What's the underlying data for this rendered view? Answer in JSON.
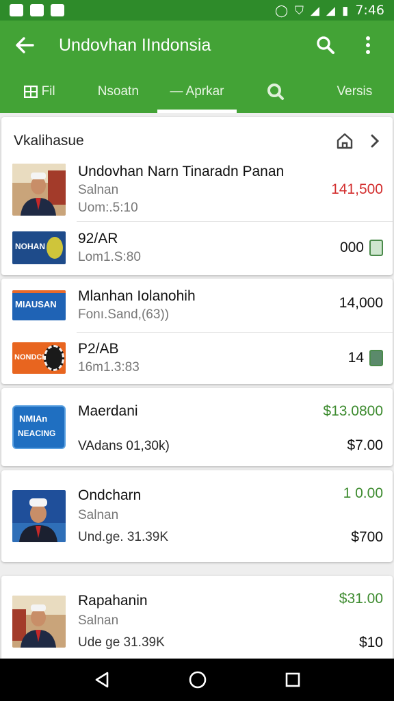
{
  "status_bar": {
    "time": "7:46"
  },
  "app_bar": {
    "title": "Undovhan IIndonsia",
    "tabs": [
      "Fil",
      "Nsoatn",
      "Aprkar",
      "",
      "Versis"
    ]
  },
  "cards": [
    {
      "header": "Vkalihasue",
      "rows": [
        {
          "title": "Undovhan Narn Tinaradn Panan",
          "sub1": "Salnan",
          "sub2": "Uom:.5:10",
          "price": "141,500"
        },
        {
          "logo_text": "NOHAN",
          "title": "92/AR",
          "sub1": "Lom1.S:80",
          "price": "000"
        }
      ]
    },
    {
      "rows": [
        {
          "logo_text": "MIAUSAN",
          "title": "Mlanhan Iolanohih",
          "sub1": "Fonı.Sand,(63))",
          "price": "14,000"
        },
        {
          "logo_text": "NONDCH",
          "title": "P2/AB",
          "sub1": "16m1.3:83",
          "price": "14"
        }
      ]
    },
    {
      "rows": [
        {
          "logo_text_1": "NMIAn",
          "logo_text_2": "NEACING",
          "title": "Maerdani",
          "sub1": "VAdans 01,30k)",
          "price_top": "$13.0800",
          "price_bottom": "$7.00"
        }
      ]
    },
    {
      "rows": [
        {
          "title": "Ondcharn",
          "sub1": "Salnan",
          "sub2": "Und.ge. 31.39K",
          "price_top": "1 0.00",
          "price_bottom": "$700"
        }
      ]
    },
    {
      "rows": [
        {
          "title": "Rapahanin",
          "sub1": "Salnan",
          "sub2": "Ude ge 31.39K",
          "price_top": "$31.00",
          "price_bottom": "$10"
        }
      ]
    }
  ]
}
